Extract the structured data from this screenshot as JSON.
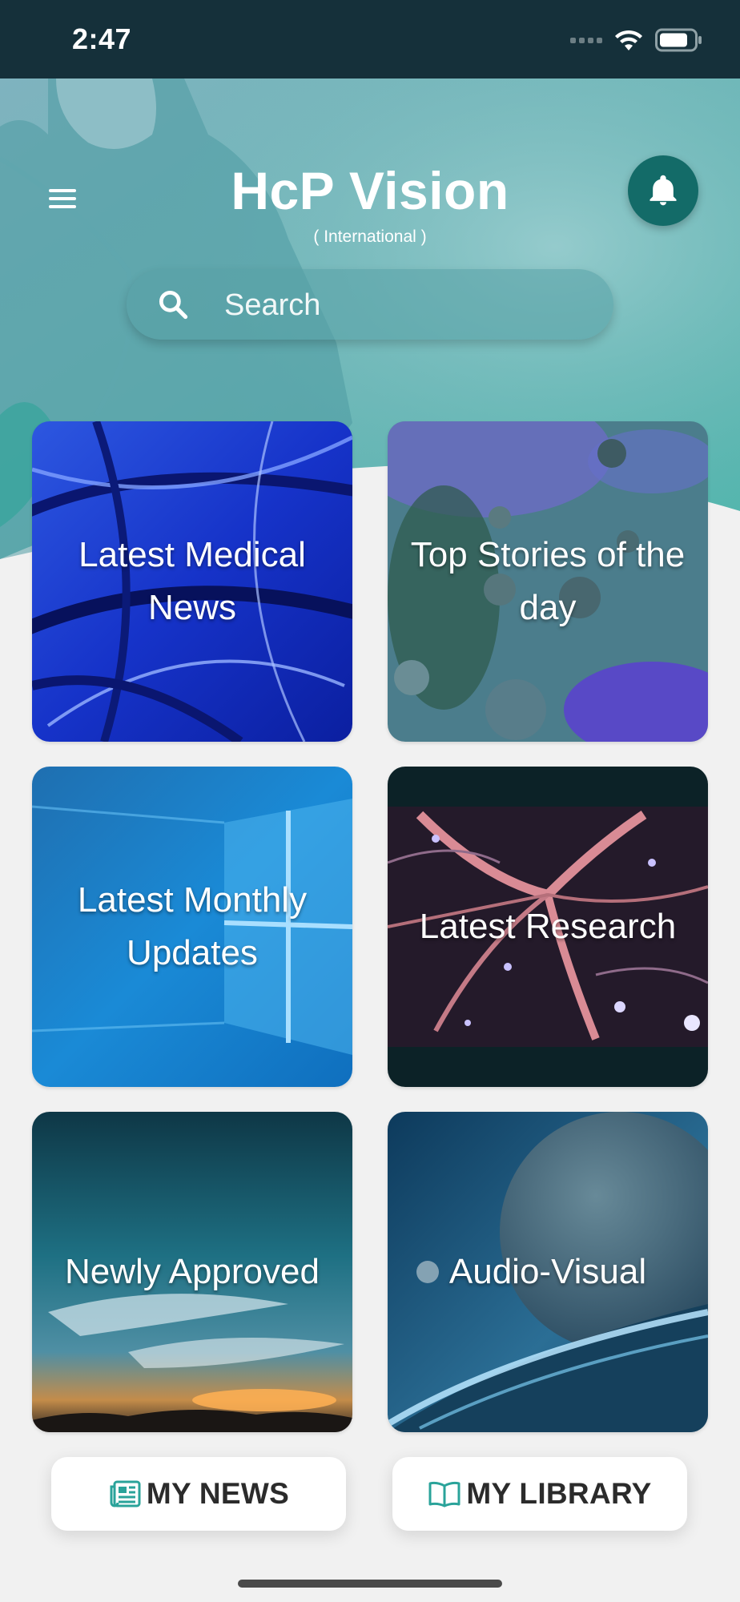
{
  "status_bar": {
    "time": "2:47",
    "icons": [
      "signal-icon",
      "wifi-icon",
      "battery-icon"
    ]
  },
  "header": {
    "title": "HcP Vision",
    "subtitle": "( International )",
    "menu_icon": "menu-icon",
    "notification_icon": "bell-icon"
  },
  "search": {
    "placeholder": "Search",
    "value": "",
    "icon": "search-icon"
  },
  "tiles": [
    {
      "label": "Latest Medical News"
    },
    {
      "label": "Top Stories of the day"
    },
    {
      "label": "Latest Monthly Updates"
    },
    {
      "label": "Latest Research"
    },
    {
      "label": "Newly Approved"
    },
    {
      "label": "Audio-Visual"
    }
  ],
  "bottom_bar": {
    "my_news": {
      "label": "MY NEWS",
      "icon": "newspaper-icon"
    },
    "my_library": {
      "label": "MY LIBRARY",
      "icon": "book-icon"
    }
  },
  "colors": {
    "header_bg": "#15303a",
    "accent": "#136b68",
    "icon_teal": "#2aa39a",
    "background": "#f1f1f1"
  }
}
